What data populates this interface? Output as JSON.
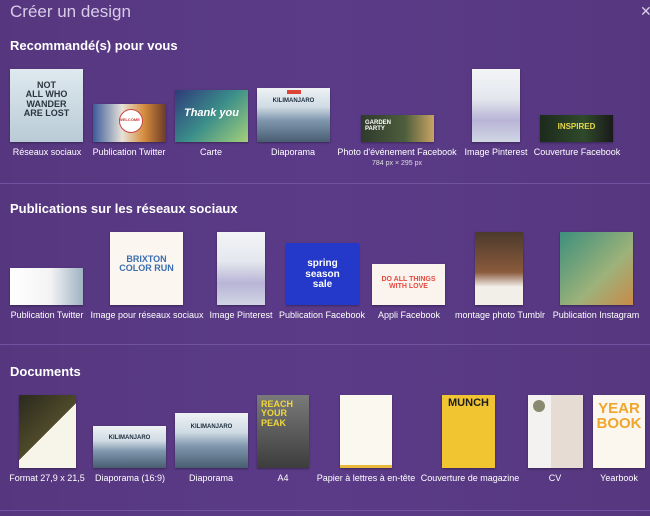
{
  "page_title": "Créer un design",
  "sections": {
    "recommended": {
      "title": "Recommandé(s) pour vous",
      "items": [
        {
          "label": "Réseaux sociaux"
        },
        {
          "label": "Publication Twitter"
        },
        {
          "label": "Carte"
        },
        {
          "label": "Diaporama"
        },
        {
          "label": "Photo d'événement Facebook",
          "sub": "784 px × 295 px"
        },
        {
          "label": "Image Pinterest"
        },
        {
          "label": "Couverture Facebook"
        }
      ]
    },
    "social": {
      "title": "Publications sur les réseaux sociaux",
      "items": [
        {
          "label": "Publication Twitter"
        },
        {
          "label": "Image pour réseaux sociaux"
        },
        {
          "label": "Image Pinterest"
        },
        {
          "label": "Publication Facebook"
        },
        {
          "label": "Appli Facebook"
        },
        {
          "label": "montage photo Tumblr"
        },
        {
          "label": "Publication Instagram"
        }
      ]
    },
    "documents": {
      "title": "Documents",
      "items": [
        {
          "label": "Format 27,9 x 21,5"
        },
        {
          "label": "Diaporama (16:9)"
        },
        {
          "label": "Diaporama"
        },
        {
          "label": "A4"
        },
        {
          "label": "Papier à lettres à en-tête"
        },
        {
          "label": "Couverture de magazine"
        },
        {
          "label": "CV"
        },
        {
          "label": "Yearbook"
        }
      ]
    }
  },
  "thumb_text": {
    "not_all": "NOT\nALL WHO\nWANDER\nARE LOST",
    "welcome": "WELCOME",
    "thank_you": "Thank you",
    "kilimanjaro": "KILIMANJARO",
    "garden_party": "GARDEN\nPARTY",
    "inspired": "INSPIRED",
    "brixton": "BRIXTON\nCOLOR RUN",
    "spring": "spring\nseason\nsale",
    "do_all": "DO ALL THINGS\nWITH LOVE",
    "reach": "REACH\nYOUR\nPEAK",
    "munch": "MUNCH",
    "yearbook": "YEAR\nBOOK"
  },
  "colors": {
    "background": "#5a3a86",
    "divider": "#6f53a0"
  }
}
